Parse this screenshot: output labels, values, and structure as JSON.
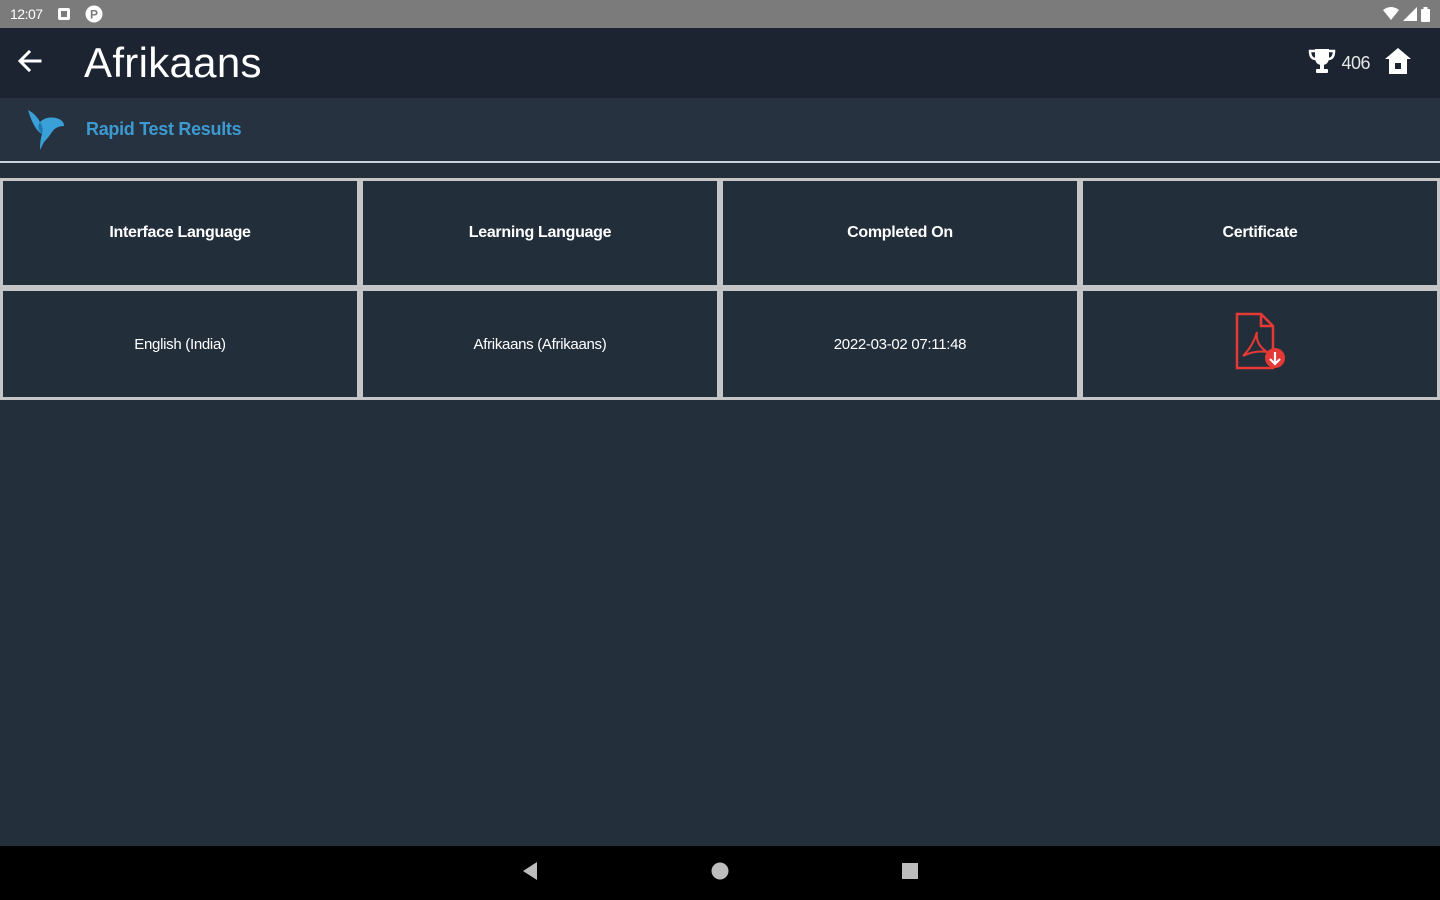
{
  "status_bar": {
    "time": "12:07",
    "icons": [
      "notification-square-icon",
      "app-p-icon",
      "wifi-icon",
      "signal-icon",
      "battery-icon"
    ]
  },
  "app_bar": {
    "title": "Afrikaans",
    "score": "406",
    "icons": [
      "back-arrow-icon",
      "trophy-icon",
      "home-icon"
    ]
  },
  "section": {
    "title": "Rapid Test Results",
    "logo": "bird-logo-icon"
  },
  "table": {
    "headers": [
      "Interface Language",
      "Learning Language",
      "Completed On",
      "Certificate"
    ],
    "rows": [
      {
        "interface_language": "English (India)",
        "learning_language": "Afrikaans (Afrikaans)",
        "completed_on": "2022-03-02 07:11:48",
        "certificate": "pdf-download-icon"
      }
    ]
  },
  "nav_bar": {
    "icons": [
      "nav-back-icon",
      "nav-home-icon",
      "nav-recents-icon"
    ]
  },
  "colors": {
    "background": "#242f3c",
    "app_bar": "#1b2430",
    "accent": "#3d9ad1",
    "pdf_red": "#e53935"
  }
}
